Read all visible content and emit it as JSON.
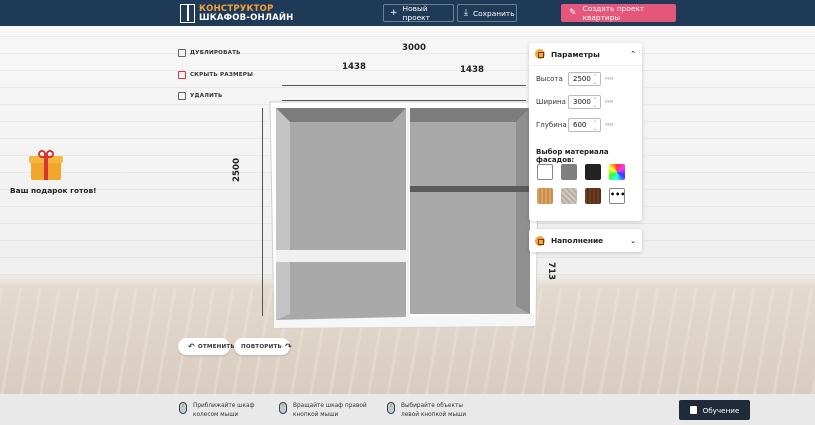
{
  "header": {
    "logo_line1": "КОНСТРУКТОР",
    "logo_line2": "ШКАФОВ-ОНЛАЙН",
    "new_project": "Новый проект",
    "save": "Сохранить",
    "create_project": "Создать проект квартиры",
    "colors": {
      "bar": "#1f3a57",
      "create_button": "#e4577a",
      "logo_accent": "#f6a23a"
    }
  },
  "tools": {
    "duplicate": "ДУБЛИРОВАТЬ",
    "hide_sizes": "СКРЫТЬ РАЗМЕРЫ",
    "delete": "УДАЛИТЬ"
  },
  "gift": {
    "text": "Ваш подарок готов!"
  },
  "dimensions": {
    "total_width": "3000",
    "section_left": "1438",
    "section_right": "1438",
    "height": "2500",
    "inner_height": "713"
  },
  "history": {
    "undo": "ОТМЕНИТЬ",
    "redo": "ПОВТОРИТЬ"
  },
  "params": {
    "title": "Параметры",
    "height_label": "Высота",
    "height_value": "2500",
    "width_label": "Ширина",
    "width_value": "3000",
    "depth_label": "Глубина",
    "depth_value": "600",
    "unit": "мм",
    "materials_title": "Выбор материала фасадов:",
    "swatches": [
      "white",
      "gray",
      "black",
      "rainbow",
      "oak",
      "stone",
      "walnut",
      "more"
    ],
    "more_label": "•••"
  },
  "filling": {
    "title": "Наполнение"
  },
  "footer": {
    "hint1_a": "Приближайте шкаф",
    "hint1_b": "колесом мыши",
    "hint2_a": "Вращайте шкаф правой",
    "hint2_b": "кнопкой мыши",
    "hint3_a": "Выбирайте объекты",
    "hint3_b": "левой кнопкой мыши",
    "learn": "Обучение"
  }
}
